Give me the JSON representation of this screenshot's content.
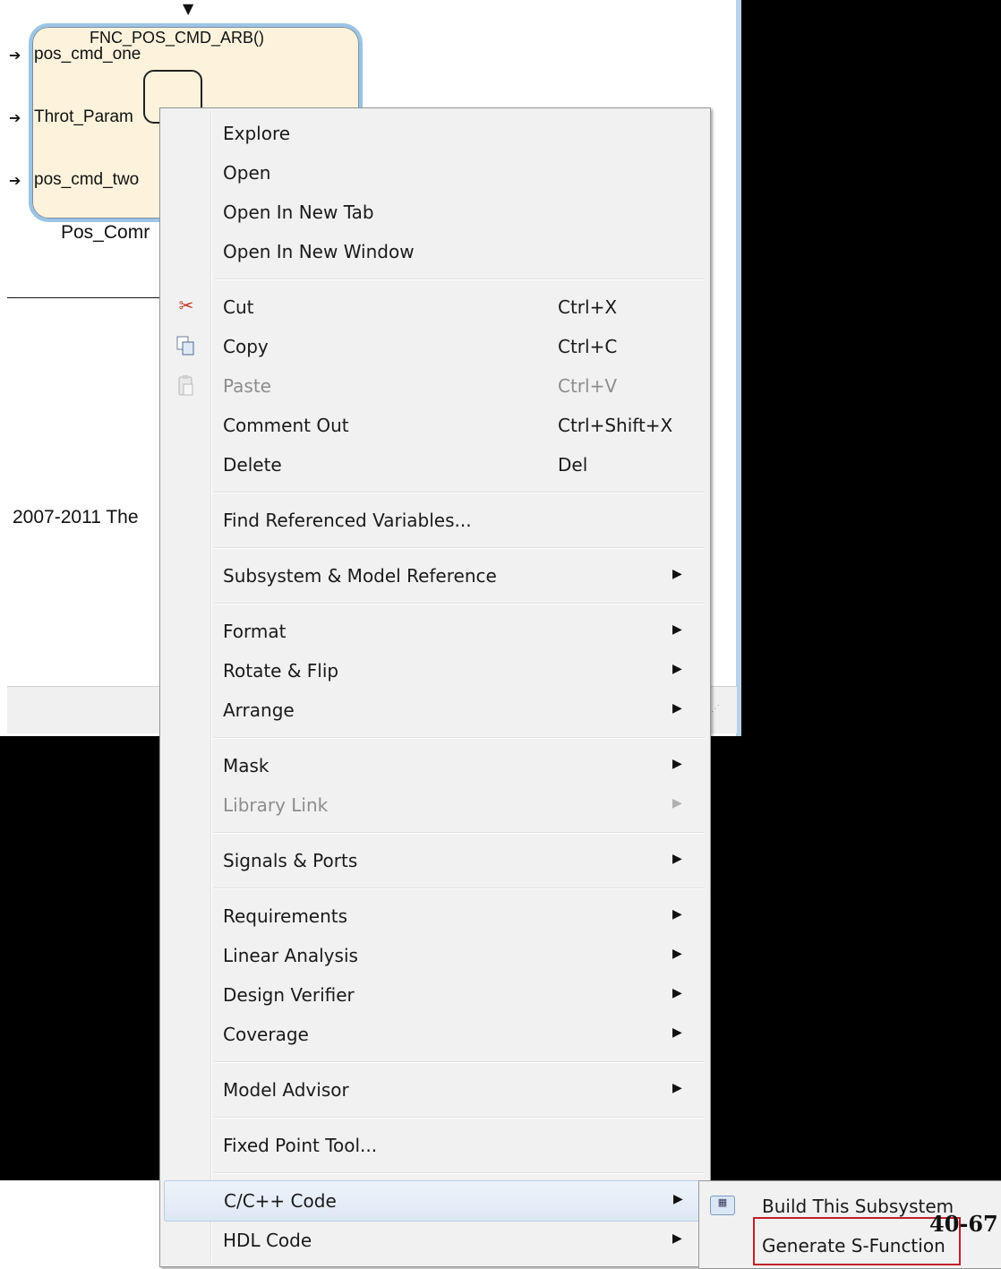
{
  "model": {
    "block_title": "FNC_POS_CMD_ARB()",
    "ports": [
      "pos_cmd_one",
      "Throt_Param",
      "pos_cmd_two"
    ],
    "block_name": "Pos_Comr",
    "copyright": "2007-2011 The"
  },
  "context_menu": {
    "items": [
      {
        "label": "Explore"
      },
      {
        "label": "Open"
      },
      {
        "label": "Open In New Tab"
      },
      {
        "label": "Open In New Window"
      },
      {
        "label": "Cut",
        "shortcut": "Ctrl+X",
        "icon": "scissors-icon"
      },
      {
        "label": "Copy",
        "shortcut": "Ctrl+C",
        "icon": "copy-icon"
      },
      {
        "label": "Paste",
        "shortcut": "Ctrl+V",
        "icon": "paste-icon",
        "disabled": true
      },
      {
        "label": "Comment Out",
        "shortcut": "Ctrl+Shift+X"
      },
      {
        "label": "Delete",
        "shortcut": "Del"
      },
      {
        "label": "Find Referenced Variables..."
      },
      {
        "label": "Subsystem & Model Reference",
        "submenu": true
      },
      {
        "label": "Format",
        "submenu": true
      },
      {
        "label": "Rotate & Flip",
        "submenu": true
      },
      {
        "label": "Arrange",
        "submenu": true
      },
      {
        "label": "Mask",
        "submenu": true
      },
      {
        "label": "Library Link",
        "submenu": true,
        "disabled": true
      },
      {
        "label": "Signals & Ports",
        "submenu": true
      },
      {
        "label": "Requirements",
        "submenu": true
      },
      {
        "label": "Linear Analysis",
        "submenu": true
      },
      {
        "label": "Design Verifier",
        "submenu": true
      },
      {
        "label": "Coverage",
        "submenu": true
      },
      {
        "label": "Model Advisor",
        "submenu": true
      },
      {
        "label": "Fixed Point Tool..."
      },
      {
        "label": "C/C++ Code",
        "submenu": true,
        "highlighted": true
      },
      {
        "label": "HDL Code",
        "submenu": true
      }
    ],
    "submenu_arrow": "▶"
  },
  "submenu": {
    "items": [
      {
        "label": "Build This Subsystem",
        "icon": "build-icon"
      },
      {
        "label": "Generate S-Function",
        "highlighted_box": true
      }
    ]
  },
  "page_number": "40-67",
  "colors": {
    "highlight_box": "#c0202a",
    "block_fill": "#fdf3dc",
    "block_border": "#9cc4e6"
  }
}
